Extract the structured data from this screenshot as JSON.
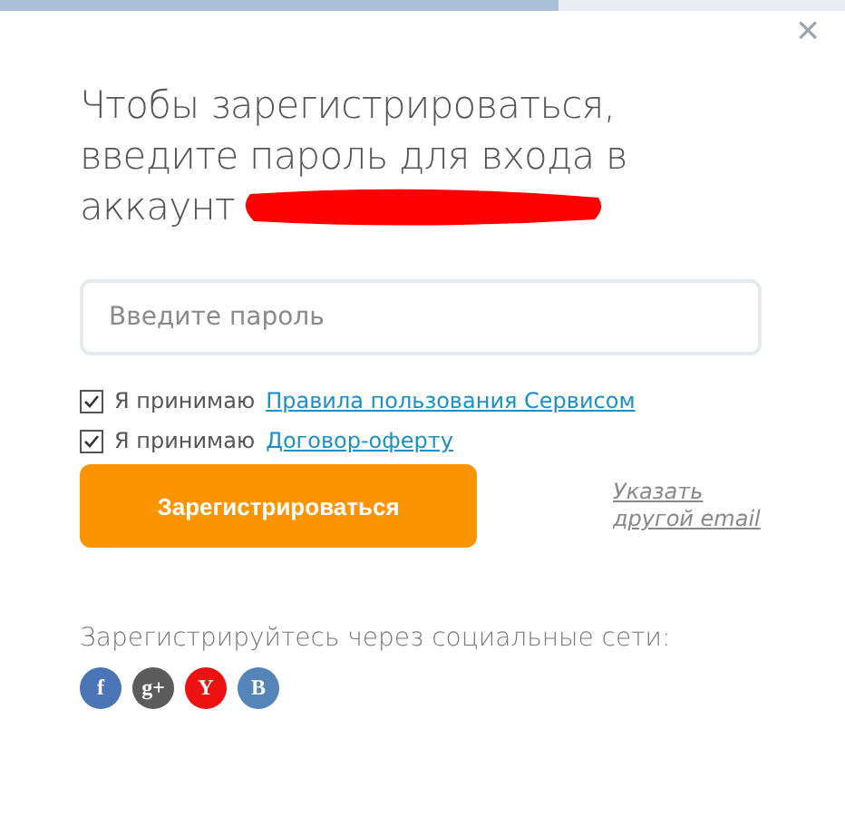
{
  "progress": {
    "level": 0.66
  },
  "close": "×",
  "title_lines": [
    "Чтобы зарегистрироваться,",
    "введите пароль для входа в",
    "аккаунт"
  ],
  "password": {
    "placeholder": "Введите пароль"
  },
  "agreements": [
    {
      "label": "Я принимаю",
      "link": "Правила пользования Сервисом",
      "checked": true
    },
    {
      "label": "Я принимаю",
      "link": "Договор-оферту",
      "checked": true
    }
  ],
  "register_button": "Зарегистрироваться",
  "other_email": "Указать другой email",
  "social": {
    "caption": "Зарегистрируйтесь через социальные сети:",
    "networks": [
      {
        "label": "f",
        "color": "#4a76b8"
      },
      {
        "label": "g+",
        "color": "#5c5c5c"
      },
      {
        "label": "Y",
        "color": "#ee1111"
      },
      {
        "label": "B",
        "color": "#5585b8"
      }
    ]
  }
}
